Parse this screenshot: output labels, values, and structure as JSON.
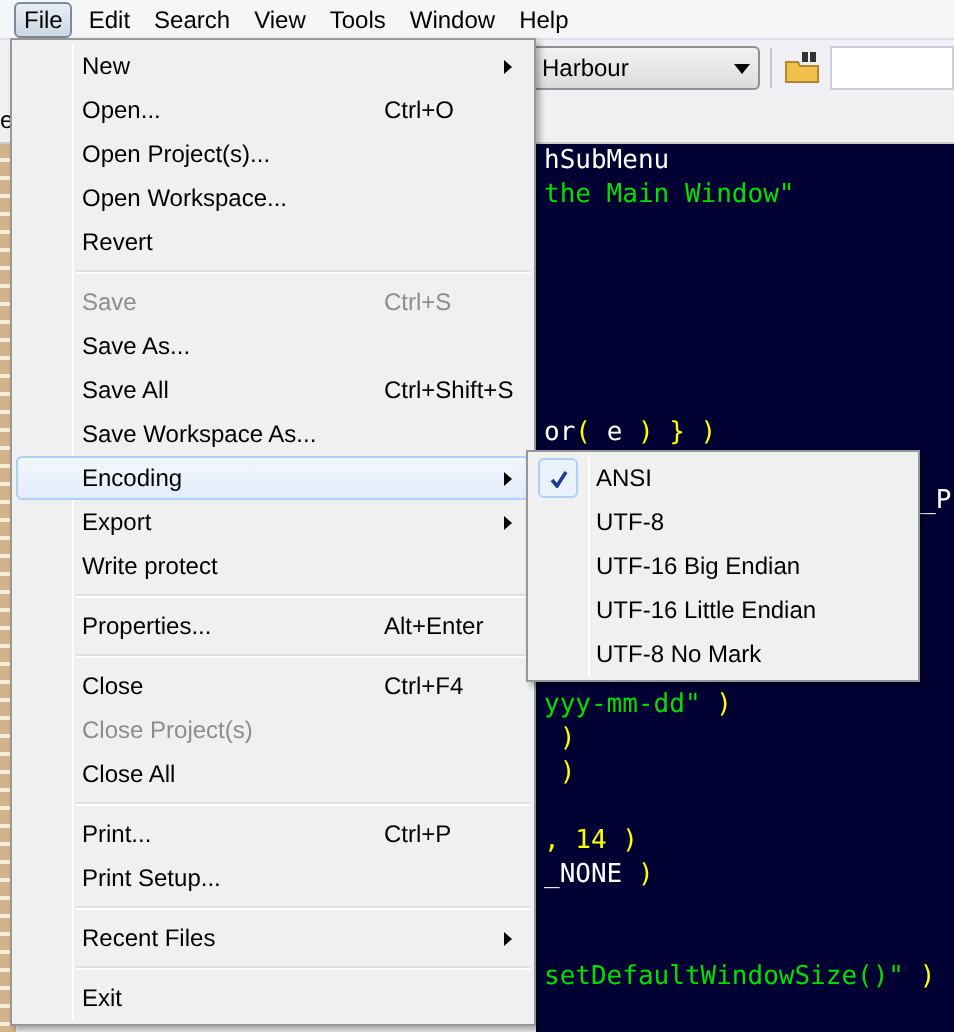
{
  "menubar": [
    {
      "label": "File",
      "selected": true
    },
    {
      "label": "Edit",
      "selected": false
    },
    {
      "label": "Search",
      "selected": false
    },
    {
      "label": "View",
      "selected": false
    },
    {
      "label": "Tools",
      "selected": false
    },
    {
      "label": "Window",
      "selected": false
    },
    {
      "label": "Help",
      "selected": false
    }
  ],
  "toolbar": {
    "combo": {
      "value": "Harbour"
    }
  },
  "tab_fragment": "e",
  "code_lines": [
    [
      {
        "text": "hSubMenu",
        "kind": "plain"
      }
    ],
    [
      {
        "text": "the Main Window\"",
        "kind": "string"
      }
    ],
    [
      {
        "text": "or",
        "kind": "plain"
      },
      {
        "text": "( ",
        "kind": "op"
      },
      {
        "text": "e",
        "kind": "plain"
      },
      {
        "text": " ) } )",
        "kind": "op"
      }
    ],
    [
      {
        "text": "_P",
        "kind": "plain"
      }
    ],
    [
      {
        "text": "yyy-mm-dd\"",
        "kind": "string"
      },
      {
        "text": " )",
        "kind": "op"
      }
    ],
    [
      {
        "text": " )",
        "kind": "op"
      }
    ],
    [
      {
        "text": " )",
        "kind": "op"
      }
    ],
    [
      {
        "text": ", 14 )",
        "kind": "op"
      }
    ],
    [
      {
        "text": "_NONE",
        "kind": "plain"
      },
      {
        "text": " )",
        "kind": "op"
      }
    ],
    [
      {
        "text": "setDefaultWindowSize()\"",
        "kind": "string"
      },
      {
        "text": " )",
        "kind": "op"
      }
    ]
  ],
  "file_menu": [
    {
      "kind": "item",
      "label": "New",
      "submenu": true,
      "disabled": false,
      "selected": false
    },
    {
      "kind": "item",
      "label": "Open...",
      "shortcut": "Ctrl+O",
      "disabled": false,
      "selected": false
    },
    {
      "kind": "item",
      "label": "Open Project(s)...",
      "disabled": false,
      "selected": false
    },
    {
      "kind": "item",
      "label": "Open Workspace...",
      "disabled": false,
      "selected": false
    },
    {
      "kind": "item",
      "label": "Revert",
      "disabled": false,
      "selected": false
    },
    {
      "kind": "separator"
    },
    {
      "kind": "item",
      "label": "Save",
      "shortcut": "Ctrl+S",
      "disabled": true,
      "selected": false
    },
    {
      "kind": "item",
      "label": "Save As...",
      "disabled": false,
      "selected": false
    },
    {
      "kind": "item",
      "label": "Save All",
      "shortcut": "Ctrl+Shift+S",
      "disabled": false,
      "selected": false
    },
    {
      "kind": "item",
      "label": "Save Workspace As...",
      "disabled": false,
      "selected": false
    },
    {
      "kind": "item",
      "label": "Encoding",
      "submenu": true,
      "disabled": false,
      "selected": true
    },
    {
      "kind": "item",
      "label": "Export",
      "submenu": true,
      "disabled": false,
      "selected": false
    },
    {
      "kind": "item",
      "label": "Write protect",
      "disabled": false,
      "selected": false
    },
    {
      "kind": "separator"
    },
    {
      "kind": "item",
      "label": "Properties...",
      "shortcut": "Alt+Enter",
      "disabled": false,
      "selected": false
    },
    {
      "kind": "separator"
    },
    {
      "kind": "item",
      "label": "Close",
      "shortcut": "Ctrl+F4",
      "disabled": false,
      "selected": false
    },
    {
      "kind": "item",
      "label": "Close Project(s)",
      "disabled": true,
      "selected": false
    },
    {
      "kind": "item",
      "label": "Close All",
      "disabled": false,
      "selected": false
    },
    {
      "kind": "separator"
    },
    {
      "kind": "item",
      "label": "Print...",
      "shortcut": "Ctrl+P",
      "disabled": false,
      "selected": false
    },
    {
      "kind": "item",
      "label": "Print Setup...",
      "disabled": false,
      "selected": false
    },
    {
      "kind": "separator"
    },
    {
      "kind": "item",
      "label": "Recent Files",
      "submenu": true,
      "disabled": false,
      "selected": false
    },
    {
      "kind": "separator"
    },
    {
      "kind": "item",
      "label": "Exit",
      "disabled": false,
      "selected": false
    }
  ],
  "encoding_menu": [
    {
      "label": "ANSI",
      "checked": true
    },
    {
      "label": "UTF-8",
      "checked": false
    },
    {
      "label": "UTF-16 Big Endian",
      "checked": false
    },
    {
      "label": "UTF-16 Little Endian",
      "checked": false
    },
    {
      "label": "UTF-8 No Mark",
      "checked": false
    }
  ]
}
